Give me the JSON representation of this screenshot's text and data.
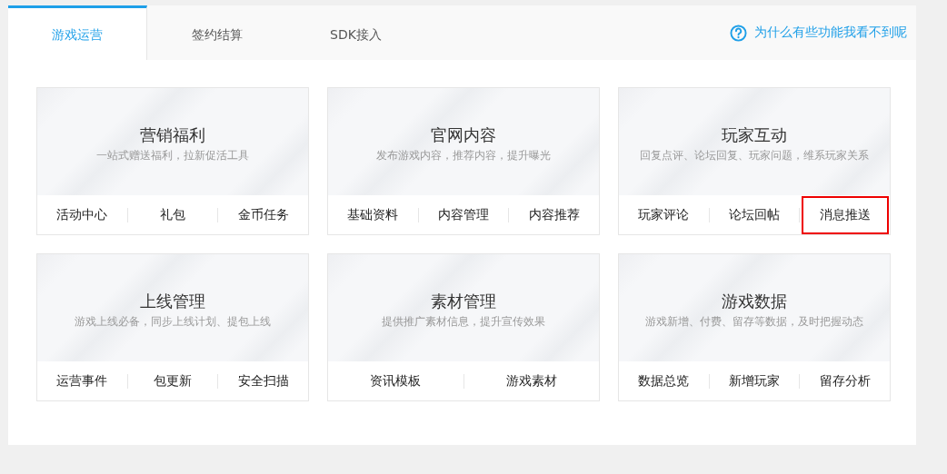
{
  "tabs": [
    {
      "label": "游戏运营",
      "selected": true
    },
    {
      "label": "签约结算",
      "selected": false
    },
    {
      "label": "SDK接入",
      "selected": false
    }
  ],
  "help_link": "为什么有些功能我看不到呢",
  "cards": [
    {
      "title": "营销福利",
      "subtitle": "一站式赠送福利，拉新促活工具",
      "links": [
        {
          "label": "活动中心",
          "highlighted": false
        },
        {
          "label": "礼包",
          "highlighted": false
        },
        {
          "label": "金币任务",
          "highlighted": false
        }
      ]
    },
    {
      "title": "官网内容",
      "subtitle": "发布游戏内容，推荐内容，提升曝光",
      "links": [
        {
          "label": "基础资料",
          "highlighted": false
        },
        {
          "label": "内容管理",
          "highlighted": false
        },
        {
          "label": "内容推荐",
          "highlighted": false
        }
      ]
    },
    {
      "title": "玩家互动",
      "subtitle": "回复点评、论坛回复、玩家问题，维系玩家关系",
      "links": [
        {
          "label": "玩家评论",
          "highlighted": false
        },
        {
          "label": "论坛回帖",
          "highlighted": false
        },
        {
          "label": "消息推送",
          "highlighted": true
        }
      ]
    },
    {
      "title": "上线管理",
      "subtitle": "游戏上线必备，同步上线计划、提包上线",
      "links": [
        {
          "label": "运营事件",
          "highlighted": false
        },
        {
          "label": "包更新",
          "highlighted": false
        },
        {
          "label": "安全扫描",
          "highlighted": false
        }
      ]
    },
    {
      "title": "素材管理",
      "subtitle": "提供推广素材信息，提升宣传效果",
      "links": [
        {
          "label": "资讯模板",
          "highlighted": false
        },
        {
          "label": "游戏素材",
          "highlighted": false
        }
      ]
    },
    {
      "title": "游戏数据",
      "subtitle": "游戏新增、付费、留存等数据，及时把握动态",
      "links": [
        {
          "label": "数据总览",
          "highlighted": false
        },
        {
          "label": "新增玩家",
          "highlighted": false
        },
        {
          "label": "留存分析",
          "highlighted": false
        }
      ]
    }
  ]
}
